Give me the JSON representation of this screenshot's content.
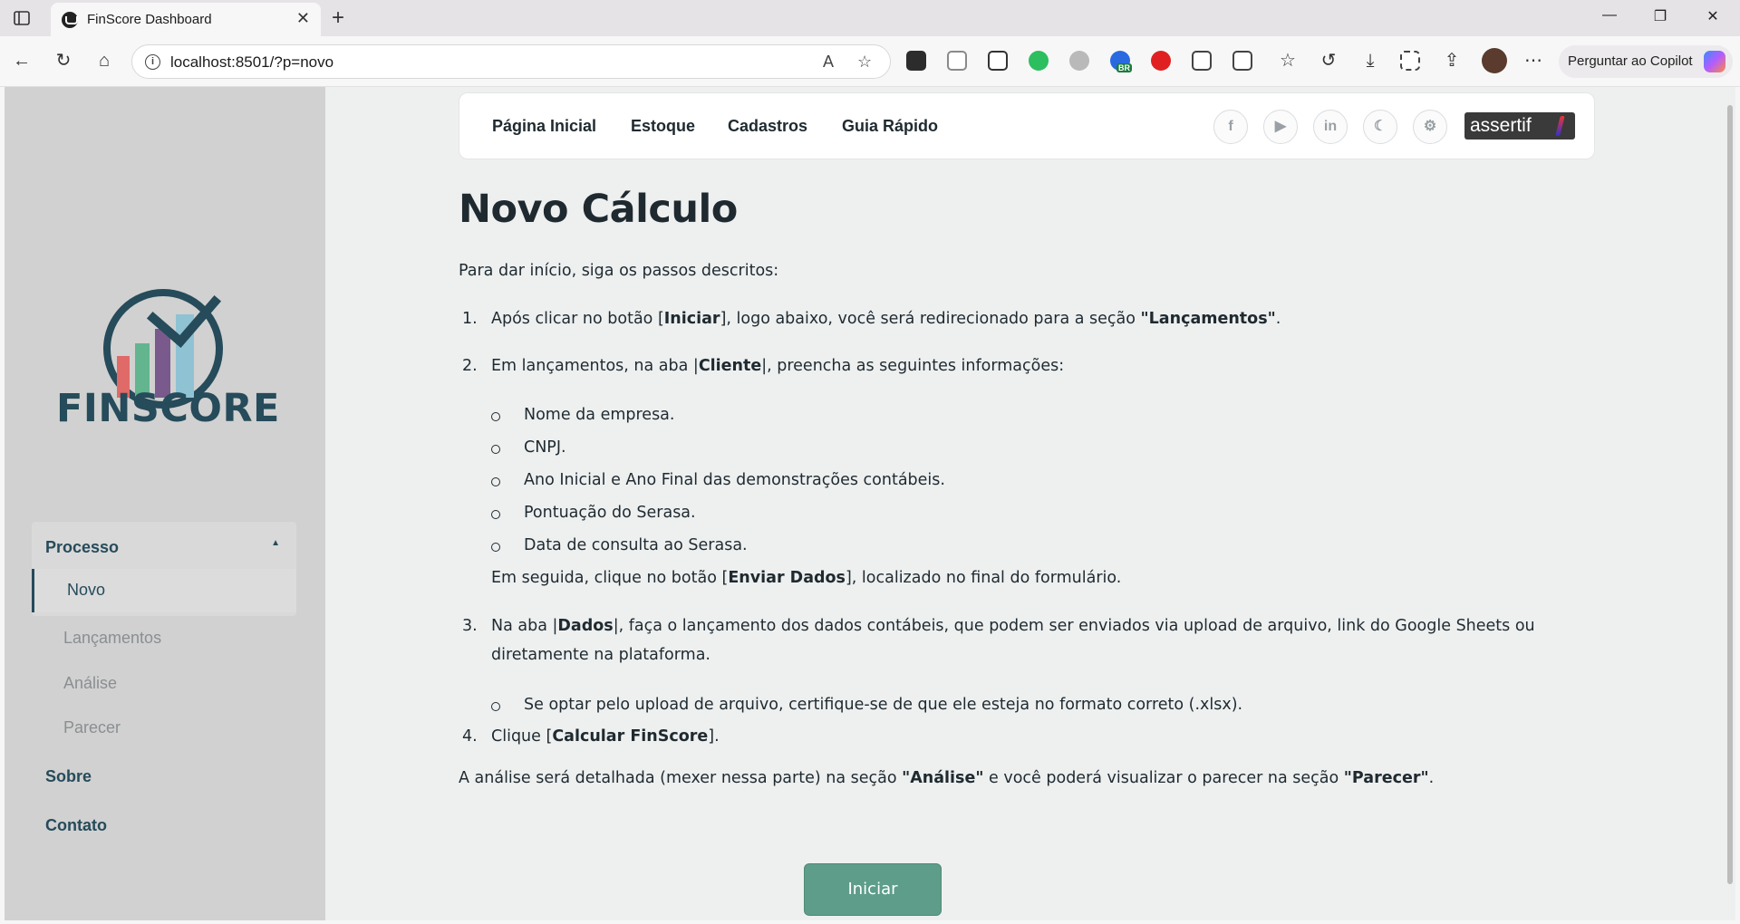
{
  "browser": {
    "tab_title": "FinScore Dashboard",
    "url": "localhost:8501/?p=novo",
    "copilot_label": "Perguntar ao Copilot",
    "ext_badge": "BR"
  },
  "navbar": {
    "links": [
      "Página Inicial",
      "Estoque",
      "Cadastros",
      "Guia Rápido"
    ],
    "brand": "assertif",
    "social_icons": [
      "facebook-icon",
      "youtube-icon",
      "linkedin-icon",
      "moon-icon",
      "gear-icon"
    ]
  },
  "sidebar": {
    "logo_text": "FINSCORE",
    "group_label": "Processo",
    "selected_item": "Novo",
    "sub_items": [
      "Lançamentos",
      "Análise",
      "Parecer"
    ],
    "top_items": [
      "Sobre",
      "Contato"
    ]
  },
  "content": {
    "title": "Novo Cálculo",
    "intro": "Para dar início, siga os passos descritos:",
    "steps": [
      {
        "num": "1.",
        "parts": [
          "Após clicar no botão [",
          "Iniciar",
          "], logo abaixo, você será redirecionado para a seção ",
          "\"Lançamentos\"",
          "."
        ]
      },
      {
        "num": "2.",
        "parts": [
          "Em lançamentos, na aba |",
          "Cliente",
          "|, preencha as seguintes informações:"
        ]
      },
      {
        "num": "3.",
        "parts": [
          "Na aba |",
          "Dados",
          "|, faça o lançamento dos dados contábeis, que podem ser enviados via upload de arquivo, link do Google Sheets ou diretamente na plataforma."
        ]
      },
      {
        "num": "4.",
        "parts": [
          "Clique [",
          "Calcular FinScore",
          "]."
        ]
      }
    ],
    "client_bullets": [
      "Nome da empresa.",
      "CNPJ.",
      "Ano Inicial e Ano Final das demonstrações contábeis.",
      "Pontuação do Serasa.",
      "Data de consulta ao Serasa."
    ],
    "step2_followup": [
      "Em seguida, clique no botão [",
      "Enviar Dados",
      "], localizado no final do formulário."
    ],
    "data_bullet": "Se optar pelo upload de arquivo, certifique-se de que ele esteja no formato correto (.xlsx).",
    "closing": [
      "A análise será detalhada (mexer nessa parte) na seção ",
      "\"Análise\"",
      " e você poderá visualizar o parecer na seção ",
      "\"Parecer\"",
      "."
    ],
    "start_button": "Iniciar"
  }
}
